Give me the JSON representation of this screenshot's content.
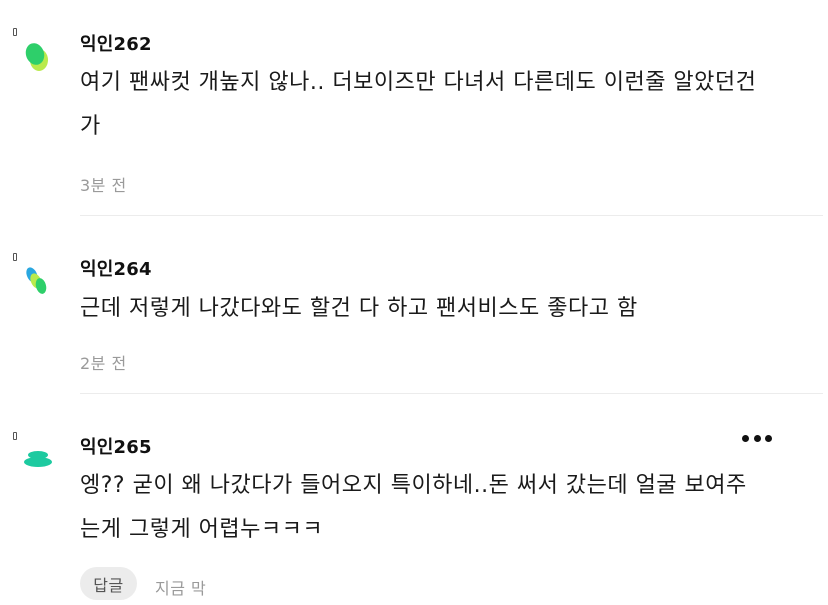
{
  "comments": [
    {
      "author": "익인262",
      "text_line1": "여기 팬싸컷 개높지 않나.. 더보이즈만 다녀서 다른데도 이런줄 알았던건",
      "text_line2": "가",
      "time": "3분 전",
      "avatar_icon": "green-blob-avatar-icon"
    },
    {
      "author": "익인264",
      "text_line1": "근데 저렇게 나갔다와도 할건 다 하고 팬서비스도 좋다고 함",
      "time": "2분 전",
      "avatar_icon": "blue-green-blob-avatar-icon"
    },
    {
      "author": "익인265",
      "text_line1": "엥?? 굳이 왜 나갔다가 들어오지 특이하네..돈 써서 갔는데 얼굴 보여주",
      "text_line2": "는게 그렇게 어렵누ㅋㅋㅋ",
      "time": "지금 막",
      "reply_label": "답글",
      "avatar_icon": "mint-disc-avatar-icon"
    }
  ],
  "colors": {
    "green": "#2ecf6a",
    "lime": "#b9ea4c",
    "blue": "#2aa7e0",
    "mint": "#1dcaa0",
    "divider": "#ececec"
  }
}
